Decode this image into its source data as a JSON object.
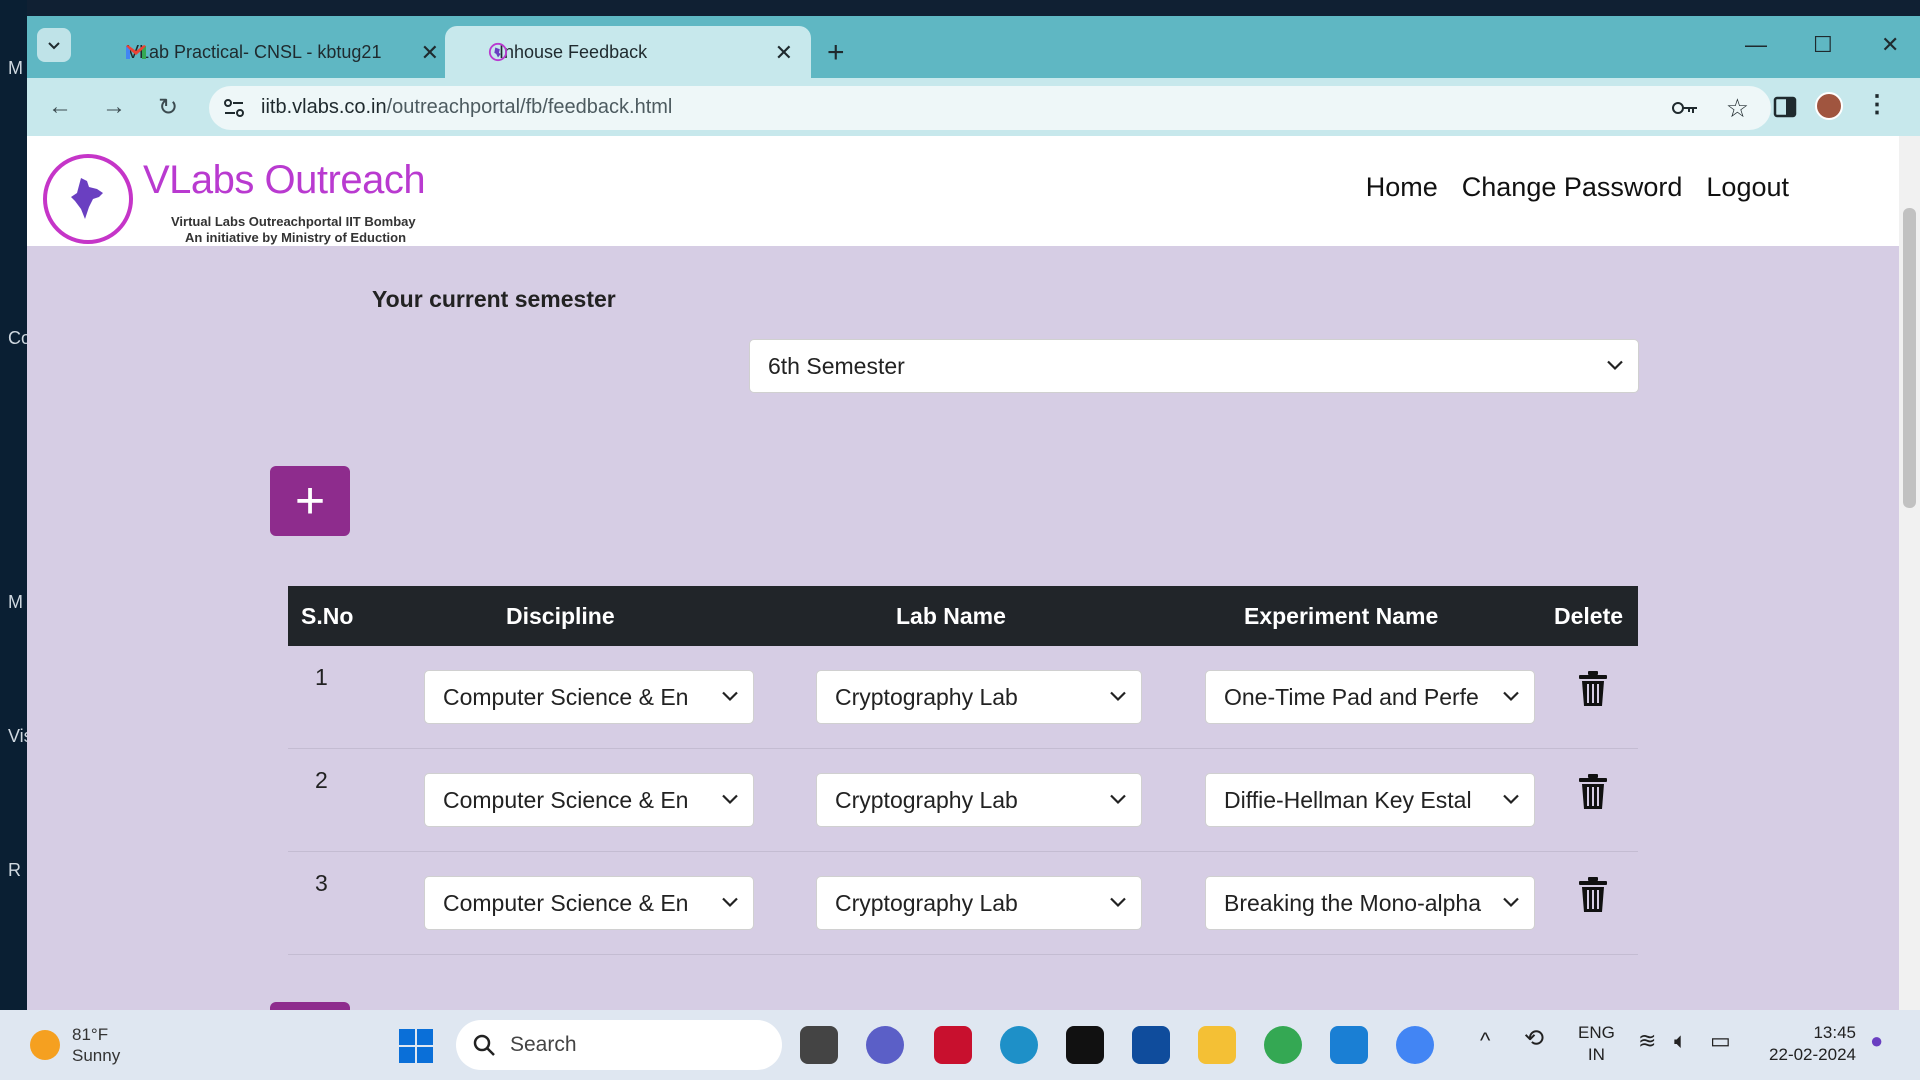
{
  "browser": {
    "tabs": [
      {
        "label": "VLab Practical- CNSL - kbtug21",
        "active": false
      },
      {
        "label": "Inhouse Feedback",
        "active": true
      }
    ],
    "url_host": "iitb.vlabs.co.in",
    "url_path": "/outreachportal/fb/feedback.html"
  },
  "header": {
    "logo_title": "VLabs Outreach",
    "logo_sub1": "Virtual Labs Outreachportal IIT Bombay",
    "logo_sub2": "An initiative by Ministry of Eduction",
    "nav": [
      "Home",
      "Change Password",
      "Logout"
    ]
  },
  "semester": {
    "label": "Your current semester",
    "value": "6th Semester"
  },
  "table": {
    "headers": [
      "S.No",
      "Discipline",
      "Lab Name",
      "Experiment Name",
      "Delete"
    ],
    "rows": [
      {
        "sno": "1",
        "discipline": "Computer Science & En",
        "lab": "Cryptography Lab",
        "experiment": "One-Time Pad and Perfe"
      },
      {
        "sno": "2",
        "discipline": "Computer Science & En",
        "lab": "Cryptography Lab",
        "experiment": "Diffie-Hellman Key Estal"
      },
      {
        "sno": "3",
        "discipline": "Computer Science & En",
        "lab": "Cryptography Lab",
        "experiment": "Breaking the Mono-alpha"
      }
    ]
  },
  "taskbar": {
    "weather_temp": "81°F",
    "weather_desc": "Sunny",
    "search_placeholder": "Search",
    "lang1": "ENG",
    "lang2": "IN",
    "time": "13:45",
    "date": "22-02-2024"
  },
  "desktop_labels": [
    "M",
    "Co",
    "M",
    "Vis",
    "R"
  ],
  "colors": {
    "accent": "#8e2c8d",
    "page_bg": "#d6cde4",
    "table_head": "#212529",
    "tab_bar": "#5fb7c3"
  }
}
